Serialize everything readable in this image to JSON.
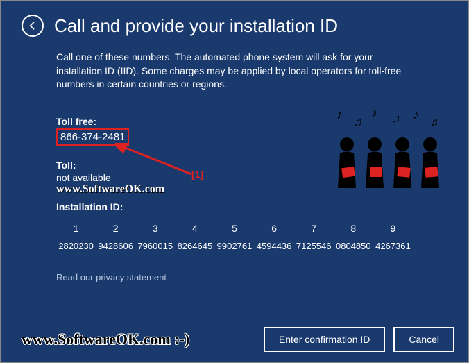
{
  "header": {
    "title": "Call and provide your installation ID"
  },
  "description": "Call one of these numbers. The automated phone system will ask for your installation ID (IID). Some charges may be applied by local operators for toll-free numbers in certain countries or regions.",
  "toll_free": {
    "label": "Toll free:",
    "value": "866-374-2481"
  },
  "toll": {
    "label": "Toll:",
    "value": "not available"
  },
  "watermark_inline": "www.SoftwareOK.com",
  "installation_id": {
    "label": "Installation ID:",
    "columns": [
      "1",
      "2",
      "3",
      "4",
      "5",
      "6",
      "7",
      "8",
      "9"
    ],
    "values": [
      "2820230",
      "9428606",
      "7960015",
      "8264645",
      "9902761",
      "4594436",
      "7125546",
      "0804850",
      "4267361"
    ]
  },
  "privacy_link": "Read our privacy statement",
  "buttons": {
    "enter": "Enter confirmation ID",
    "cancel": "Cancel"
  },
  "annotation_label": "[1]",
  "bottom_watermark": "www.SoftwareOK.com :-)"
}
